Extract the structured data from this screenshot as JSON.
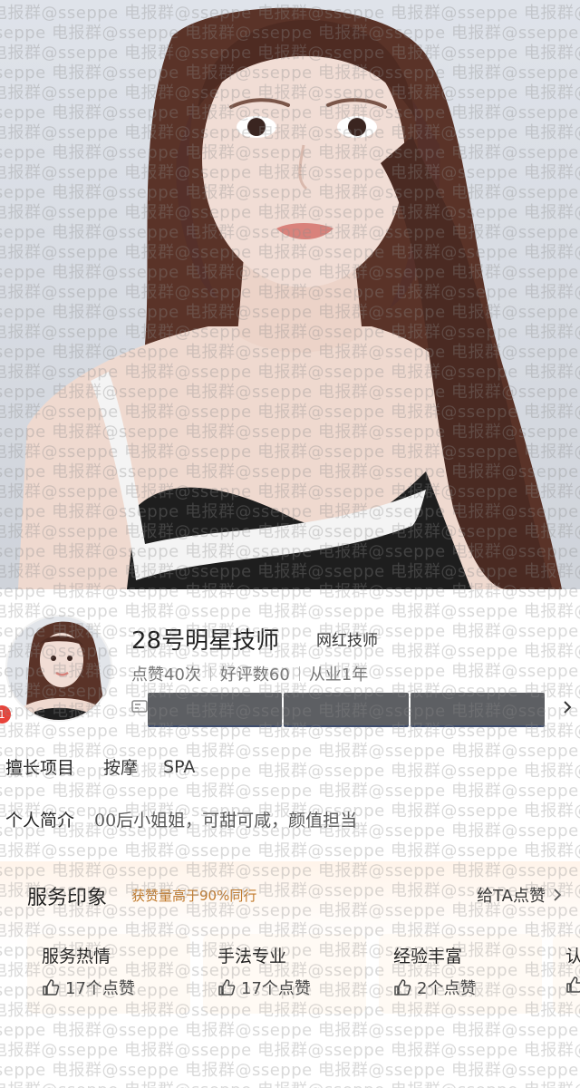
{
  "profile": {
    "name": "28号明星技师",
    "title_tag": "网红技师",
    "stats": [
      "点赞40次",
      "好评数60",
      "从业1年"
    ],
    "left_badge": "1",
    "skill_label": "擅长项目",
    "skills": [
      "按摩",
      "SPA"
    ],
    "intro_label": "个人简介",
    "intro_text": "00后小姐姐，可甜可咸，颜值担当"
  },
  "impression": {
    "title": "服务印象",
    "subtitle": "获赞量高于90%同行",
    "like_link": "给TA点赞",
    "tags": [
      {
        "name": "服务热情",
        "likes": "17个点赞"
      },
      {
        "name": "手法专业",
        "likes": "17个点赞"
      },
      {
        "name": "经验丰富",
        "likes": "2个点赞"
      },
      {
        "name": "认",
        "likes": ""
      }
    ]
  },
  "watermark": {
    "text": "电报群@sseppe  电报群@sseppe  电报群@sseppe  电报群@sseppe  电报群@sseppe  电报群@sseppe"
  },
  "colors": {
    "accent_orange": "#c17a2c",
    "badge_red": "#e8433a",
    "redaction": "#5d5f63"
  }
}
